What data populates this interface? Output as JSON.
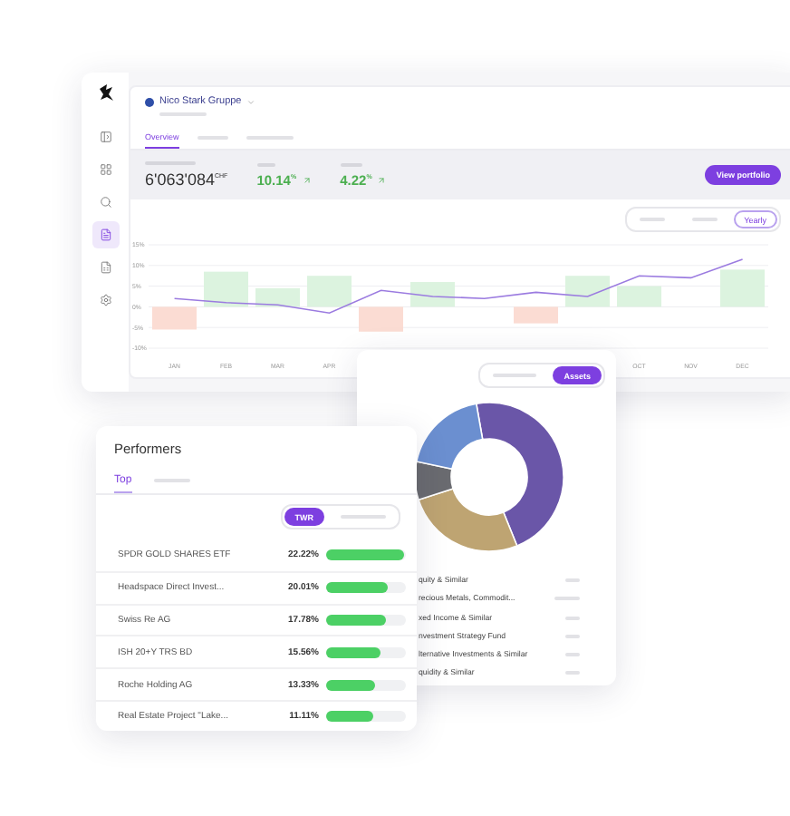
{
  "dashboard": {
    "sidebar": {
      "items": [
        {
          "kind": "panel",
          "selected": false
        },
        {
          "kind": "grid",
          "selected": false
        },
        {
          "kind": "search",
          "selected": false
        },
        {
          "kind": "document",
          "selected": true
        },
        {
          "kind": "report",
          "selected": false
        },
        {
          "kind": "settings",
          "selected": false
        }
      ]
    },
    "company": {
      "name": "Nico Stark Gruppe"
    },
    "tabs": [
      {
        "label": "Overview",
        "selected": true
      },
      {
        "selected": false
      },
      {
        "selected": false
      }
    ],
    "stats": [
      {
        "kind": "amount",
        "value": "6'063'084",
        "unit": "CHF"
      },
      {
        "kind": "change",
        "value": "10.14",
        "unit": "%"
      },
      {
        "kind": "change",
        "value": "4.22",
        "unit": "%"
      }
    ],
    "view_button": "View portfolio",
    "range_options": [
      {
        "selected": false
      },
      {
        "selected": false
      },
      {
        "label": "Yearly",
        "selected": true
      }
    ],
    "chart_data": {
      "type": "bar",
      "categories": [
        "JAN",
        "FEB",
        "MAR",
        "APR",
        null,
        null,
        null,
        null,
        null,
        "OCT",
        "NOV",
        "DEC"
      ],
      "ylim": [
        -10,
        15
      ],
      "grid": true,
      "yticks": [
        {
          "value": 15,
          "label": "15%"
        },
        {
          "value": 10,
          "label": "10%"
        },
        {
          "value": 5,
          "label": "5%"
        },
        {
          "value": 0,
          "label": "0%"
        },
        {
          "value": -5,
          "label": "-5%"
        },
        {
          "value": -10,
          "label": "-10%"
        }
      ],
      "series": [
        {
          "type": "bar",
          "colors": [
            "#fbdcd3",
            "#dcf3df",
            "#dcf3df",
            "#dcf3df",
            "#fbdcd3",
            "#dcf3df",
            null,
            "#fbdcd3",
            "#dcf3df",
            "#dcf3df",
            null,
            "#dcf3df"
          ],
          "values": [
            -5.5,
            8.5,
            4.5,
            7.5,
            -6,
            6,
            null,
            -4,
            7.5,
            5,
            null,
            9
          ]
        },
        {
          "type": "line",
          "color": "#9b7be0",
          "values": [
            2,
            1,
            0.5,
            -1.5,
            4,
            2.5,
            2,
            3.5,
            2.5,
            7.5,
            7,
            11.5
          ]
        }
      ]
    }
  },
  "allocation": {
    "toggle": [
      {
        "selected": false
      },
      {
        "label": "Assets",
        "selected": true
      }
    ],
    "legend": [
      "quity & Similar",
      "recious Metals, Commodit...",
      "xed Income & Similar",
      "nvestment Strategy Fund",
      "lternative Investments & Similar",
      "quidity & Similar"
    ]
  },
  "performers": {
    "title": "Performers",
    "tabs": [
      {
        "label": "Top",
        "selected": true
      },
      {
        "selected": false
      }
    ],
    "metric_toggle": [
      {
        "label": "TWR",
        "selected": true
      },
      {
        "selected": false
      }
    ],
    "rows": [
      {
        "name": "SPDR GOLD SHARES ETF",
        "value": "22.22%",
        "level": 0.98
      },
      {
        "name": "Headspace Direct Invest...",
        "value": "20.01%",
        "level": 0.78
      },
      {
        "name": "Swiss Re AG",
        "value": "17.78%",
        "level": 0.74
      },
      {
        "name": "ISH 20+Y TRS BD",
        "value": "15.56%",
        "level": 0.68
      },
      {
        "name": "Roche Holding AG",
        "value": "13.33%",
        "level": 0.62
      },
      {
        "name": "Real Estate Project \"Lake...",
        "value": "11.11%",
        "level": 0.59
      }
    ]
  }
}
